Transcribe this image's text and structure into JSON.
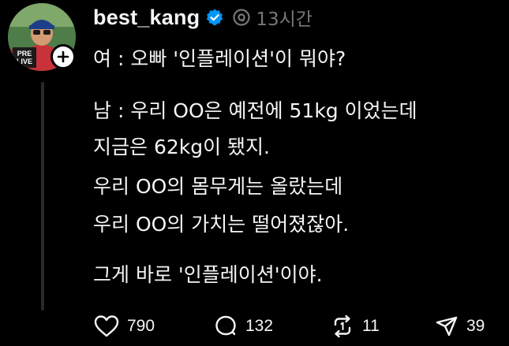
{
  "post": {
    "username": "best_kang",
    "time": "13시간",
    "lines": [
      "여 : 오빠 '인플레이션'이 뭐야?",
      "남 : 우리 OO은 예전에 51kg 이었는데",
      "지금은 62kg이 됐지.",
      "우리 OO의 몸무게는 올랐는데",
      "우리 OO의 가치는 떨어졌잖아.",
      "그게 바로 '인플레이션'이야."
    ],
    "avatar_text": "PRE LIVE"
  },
  "actions": {
    "likes": "790",
    "replies": "132",
    "reposts": "11",
    "shares": "39"
  },
  "icons": {
    "verified": "verified-badge-icon",
    "threads": "threads-logo-icon",
    "follow": "plus-icon",
    "like": "heart-icon",
    "reply": "comment-bubble-icon",
    "repost": "repost-icon",
    "share": "send-icon"
  },
  "colors": {
    "background": "#000000",
    "text": "#f3f5f7",
    "muted": "#777777",
    "verified": "#0095f6"
  }
}
